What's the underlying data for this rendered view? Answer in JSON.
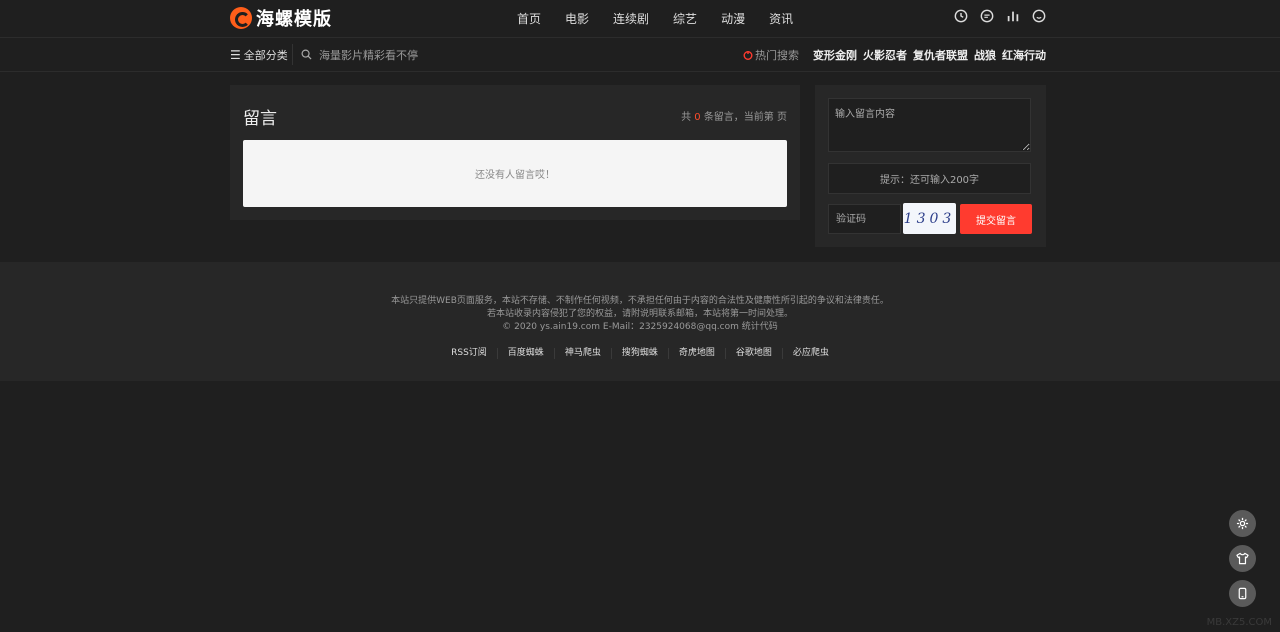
{
  "header": {
    "logo_text": "海螺模版",
    "nav": [
      "首页",
      "电影",
      "连续剧",
      "综艺",
      "动漫",
      "资讯"
    ],
    "icons": [
      "clock-icon",
      "chat-icon",
      "chart-icon",
      "smile-icon"
    ]
  },
  "subbar": {
    "category_label": "全部分类",
    "search_placeholder": "海量影片精彩看不停",
    "hot_label": "热门搜索",
    "hot_items": [
      "变形金刚",
      "火影忍者",
      "复仇者联盟",
      "战狼",
      "红海行动"
    ]
  },
  "guestbook": {
    "title": "留言",
    "count_prefix": "共",
    "count_value": "0",
    "count_suffix": "条留言，当前第",
    "count_end": "页",
    "empty_text": "还没有人留言哎！"
  },
  "form": {
    "message_placeholder": "输入留言内容",
    "tip": "提示：还可输入200字",
    "captcha_placeholder": "验证码",
    "captcha_text": "1303",
    "submit_label": "提交留言"
  },
  "footer": {
    "line1": "本站只提供WEB页面服务，本站不存储、不制作任何视频，不承担任何由于内容的合法性及健康性所引起的争议和法律责任。",
    "line2": "若本站收录内容侵犯了您的权益，请附说明联系邮箱，本站将第一时间处理。",
    "line3": "© 2020 ys.ain19.com  E-Mail：2325924068@qq.com  统计代码",
    "links": [
      "RSS订阅",
      "百度蜘蛛",
      "神马爬虫",
      "搜狗蜘蛛",
      "奇虎地图",
      "谷歌地图",
      "必应爬虫"
    ]
  },
  "float_buttons": [
    "gear-icon",
    "shirt-icon",
    "phone-icon"
  ],
  "watermark": "MB.XZ5.COM",
  "colors": {
    "accent": "#ff3b2f",
    "logo": "#ff5e1a",
    "bg": "#1f1f1f",
    "panel": "#272727"
  }
}
